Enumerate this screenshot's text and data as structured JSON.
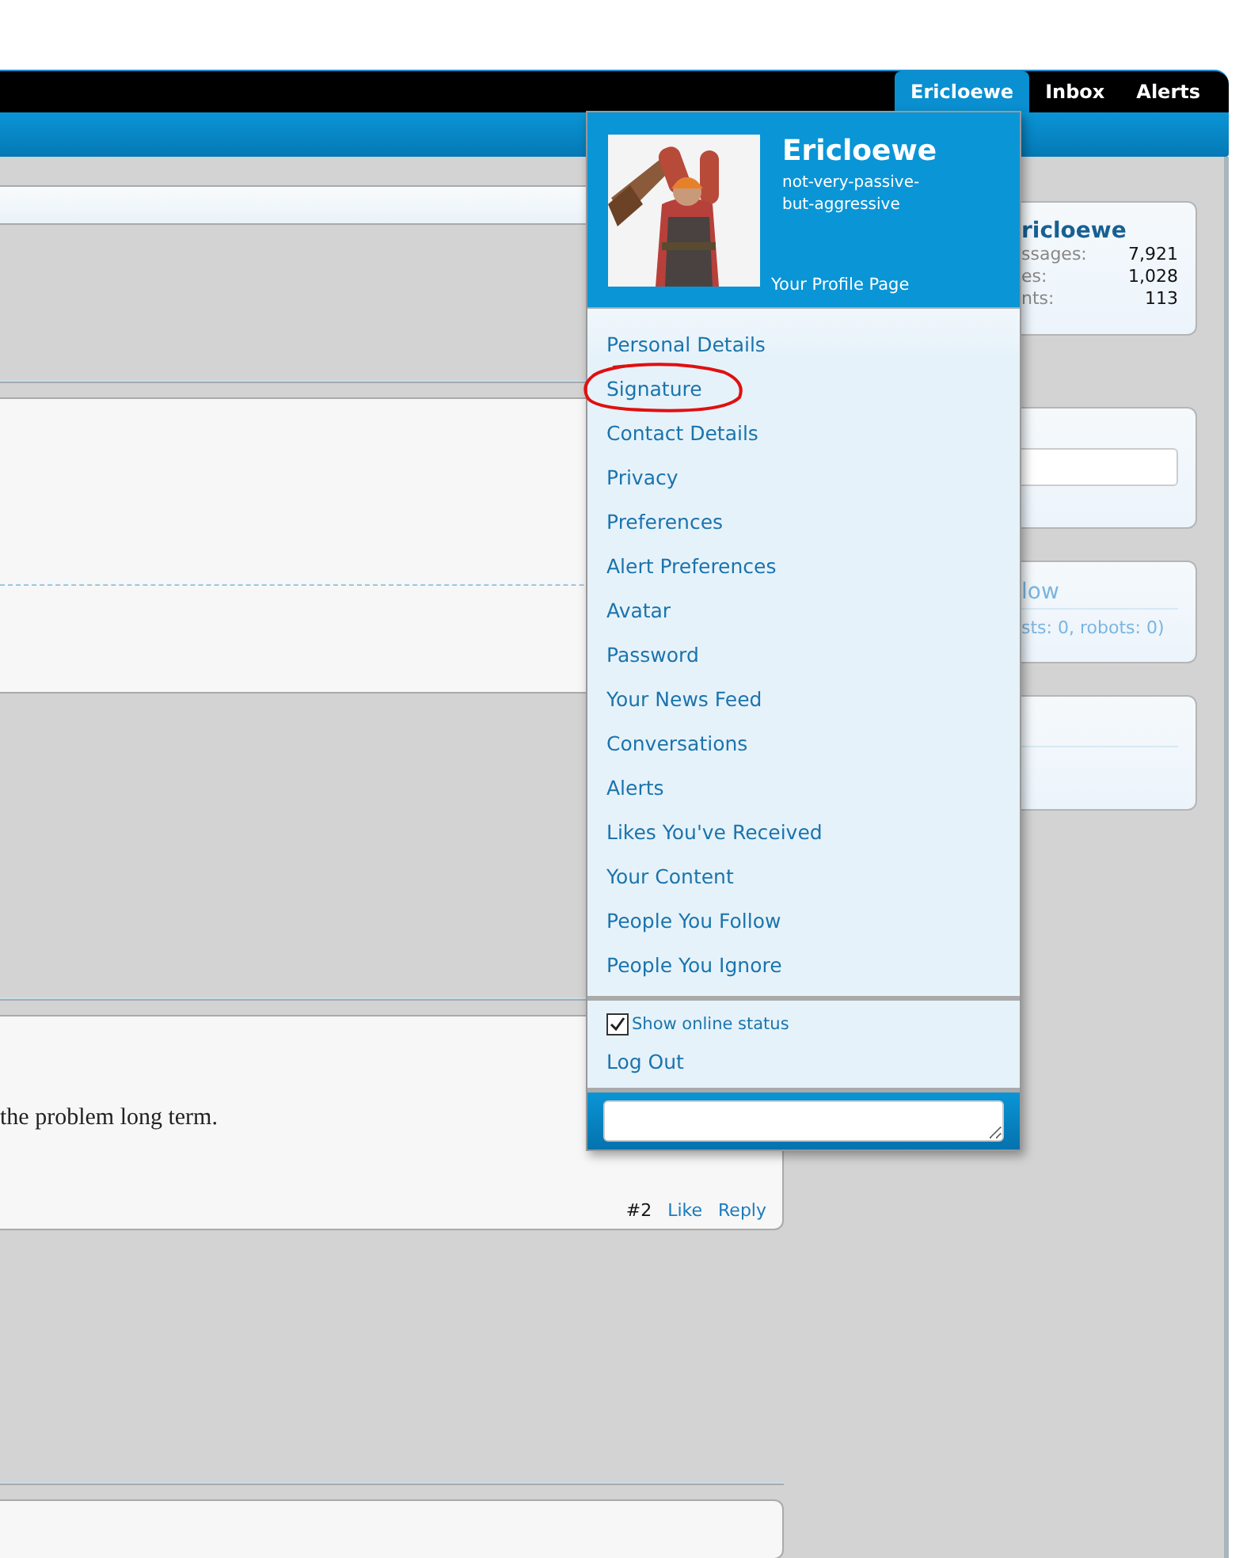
{
  "nav": {
    "tabs": [
      {
        "label": "Ericloewe",
        "selected": true
      },
      {
        "label": "Inbox",
        "selected": false
      },
      {
        "label": "Alerts",
        "selected": false
      }
    ]
  },
  "post": {
    "text": "the problem long term.",
    "number": "#2",
    "actions": [
      "Like",
      "Reply"
    ]
  },
  "sidebar": {
    "profile_card": {
      "name": "ricloewe",
      "stats": [
        {
          "label": "ssages:",
          "value": "7,921"
        },
        {
          "label": "es:",
          "value": "1,028"
        },
        {
          "label": "nts:",
          "value": "113"
        }
      ]
    },
    "online_card": {
      "heading": "low",
      "summary": "sts: 0, robots: 0)"
    }
  },
  "account_menu": {
    "name": "Ericloewe",
    "user_title": "not-very-passive-but-aggressive",
    "profile_link": "Your Profile Page",
    "items": [
      {
        "label": "Personal Details",
        "circled": false
      },
      {
        "label": "Signature",
        "circled": true
      },
      {
        "label": "Contact Details",
        "circled": false
      },
      {
        "label": "Privacy",
        "circled": false
      },
      {
        "label": "Preferences",
        "circled": false
      },
      {
        "label": "Alert Preferences",
        "circled": false
      },
      {
        "label": "Avatar",
        "circled": false
      },
      {
        "label": "Password",
        "circled": false
      },
      {
        "label": "Your News Feed",
        "circled": false
      },
      {
        "label": "Conversations",
        "circled": false
      },
      {
        "label": "Alerts",
        "circled": false
      },
      {
        "label": "Likes You've Received",
        "circled": false
      },
      {
        "label": "Your Content",
        "circled": false
      },
      {
        "label": "People You Follow",
        "circled": false
      },
      {
        "label": "People You Ignore",
        "circled": false
      }
    ],
    "show_online_status": {
      "label": "Show online status",
      "checked": true
    },
    "log_out": "Log Out"
  }
}
